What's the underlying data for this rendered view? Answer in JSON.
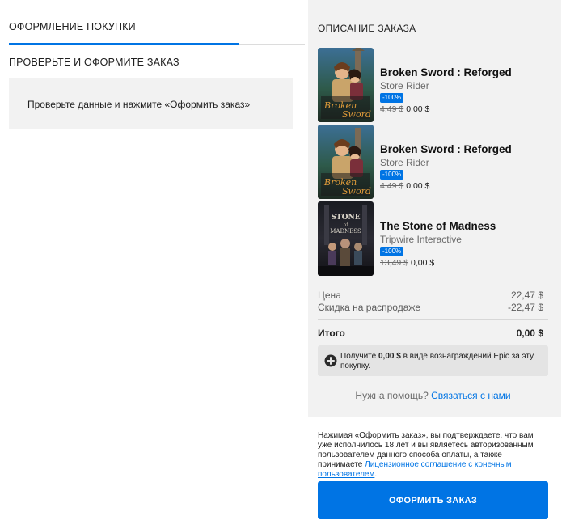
{
  "checkout": {
    "tab_label": "ОФОРМЛЕНИЕ ПОКУПКИ",
    "section_title": "ПРОВЕРЬТЕ И ОФОРМИТЕ ЗАКАЗ",
    "review_text": "Проверьте данные и нажмите «Оформить заказ»"
  },
  "summary": {
    "title": "ОПИСАНИЕ ЗАКАЗА",
    "items": [
      {
        "title": "Broken Sword : Reforged",
        "publisher": "Store Rider",
        "discount": "-100%",
        "old_price": "4,49 $",
        "new_price": "0,00 $",
        "cover_icon": "broken-sword-cover"
      },
      {
        "title": "Broken Sword : Reforged",
        "publisher": "Store Rider",
        "discount": "-100%",
        "old_price": "4,49 $",
        "new_price": "0,00 $",
        "cover_icon": "broken-sword-cover"
      },
      {
        "title": "The Stone of Madness",
        "publisher": "Tripwire Interactive",
        "discount": "-100%",
        "old_price": "13,49 $",
        "new_price": "0,00 $",
        "cover_icon": "stone-of-madness-cover"
      }
    ],
    "price_label": "Цена",
    "price_value": "22,47 $",
    "sale_label": "Скидка на распродаже",
    "sale_value": "-22,47 $",
    "total_label": "Итого",
    "total_value": "0,00 $",
    "reward_prefix": "Получите",
    "reward_amount": "0,00 $",
    "reward_suffix": "в виде вознаграждений Epic за эту покупку.",
    "help_text": "Нужна помощь?",
    "help_link": "Связаться с нами",
    "legal_text": "Нажимая «Оформить заказ», вы подтверждаете, что вам уже исполнилось 18 лет и вы являетесь авторизованным пользователем данного способа оплаты, а также принимаете",
    "legal_link": "Лицензионное соглашение с конечным пользователем",
    "legal_end": ".",
    "order_button": "ОФОРМИТЬ ЗАКАЗ"
  },
  "colors": {
    "accent": "#0074e4",
    "panel": "#f2f2f2",
    "reward_bg": "#e4e4e4"
  }
}
